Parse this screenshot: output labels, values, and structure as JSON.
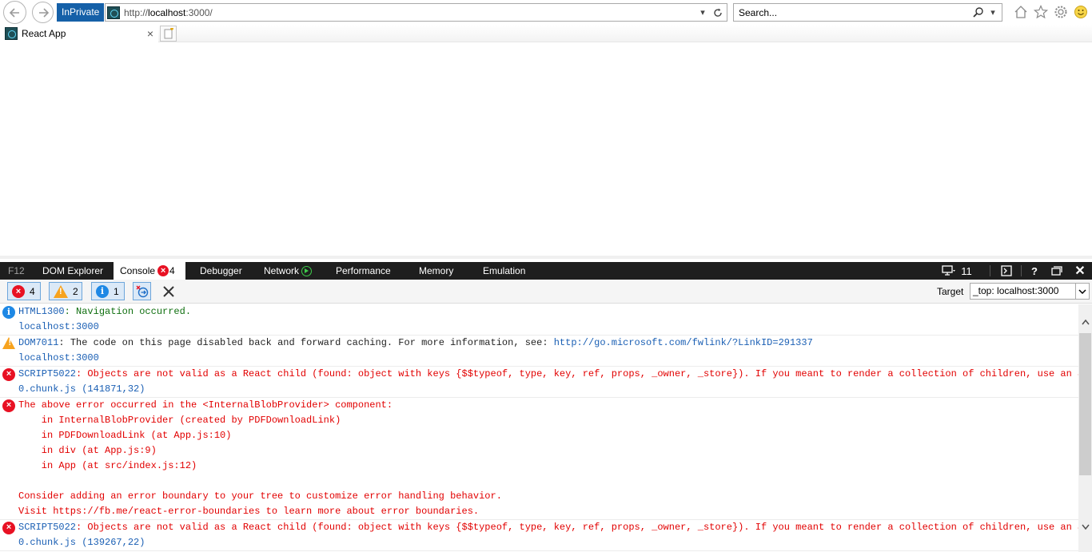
{
  "browser": {
    "inprivate_label": "InPrivate",
    "url_prefix": "http://",
    "url_host": "localhost",
    "url_suffix": ":3000/",
    "search_placeholder": "Search...",
    "tab_title": "React App"
  },
  "devtools": {
    "tabs": {
      "f12": "F12",
      "dom": "DOM Explorer",
      "console": "Console",
      "console_errors": "4",
      "debugger": "Debugger",
      "network": "Network",
      "performance": "Performance",
      "memory": "Memory",
      "emulation": "Emulation"
    },
    "emulation_mode": "11",
    "filters": {
      "errors": "4",
      "warnings": "2",
      "info": "1"
    },
    "target_label": "Target",
    "target_value": "_top: localhost:3000"
  },
  "console": {
    "messages": [
      {
        "code": "HTML1300",
        "text": ": Navigation occurred.",
        "source": "localhost:3000"
      },
      {
        "code": "DOM7011",
        "text": ": The code on this page disabled back and forward caching. For more information, see: ",
        "link": "http://go.microsoft.com/fwlink/?LinkID=291337",
        "source": "localhost:3000"
      },
      {
        "code": "SCRIPT5022",
        "text": ": Objects are not valid as a React child (found: object with keys {$$typeof, type, key, ref, props, _owner, _store}). If you meant to render a collection of children, use an array instead.",
        "source": "0.chunk.js (141871,32)"
      },
      {
        "lines": [
          "The above error occurred in the <InternalBlobProvider> component:",
          "    in InternalBlobProvider (created by PDFDownloadLink)",
          "    in PDFDownloadLink (at App.js:10)",
          "    in div (at App.js:9)",
          "    in App (at src/index.js:12)",
          "",
          "Consider adding an error boundary to your tree to customize error handling behavior.",
          "Visit https://fb.me/react-error-boundaries to learn more about error boundaries."
        ]
      },
      {
        "code": "SCRIPT5022",
        "text": ": Objects are not valid as a React child (found: object with keys {$$typeof, type, key, ref, props, _owner, _store}). If you meant to render a collection of children, use an array instead.",
        "source": "0.chunk.js (139267,22)"
      }
    ]
  }
}
